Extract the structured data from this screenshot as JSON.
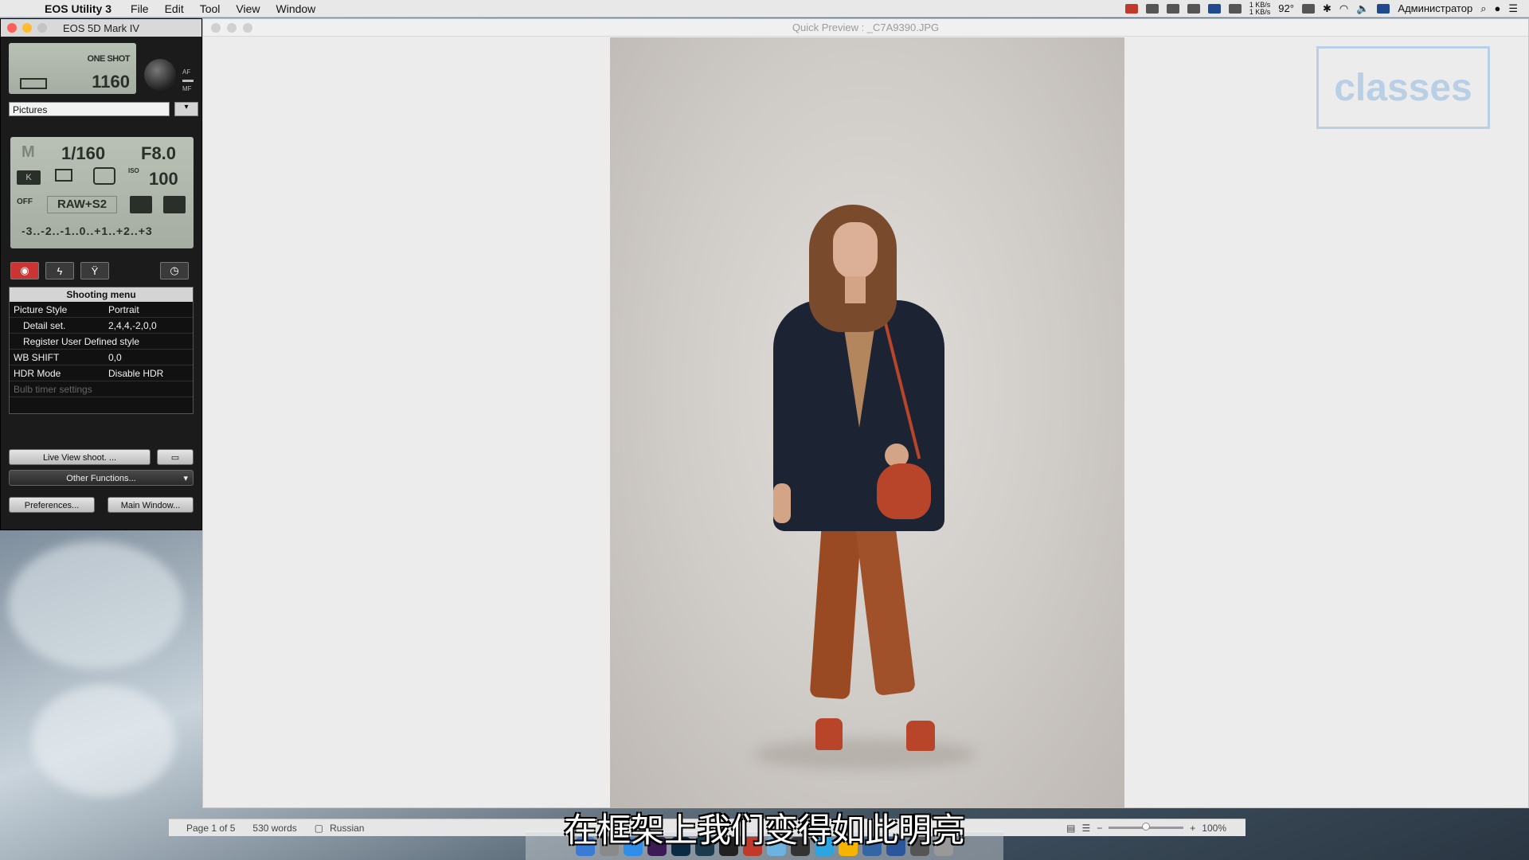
{
  "menubar": {
    "app_name": "EOS Utility 3",
    "menus": [
      "File",
      "Edit",
      "Tool",
      "View",
      "Window"
    ],
    "net_up": "1 KB/s",
    "net_down": "1 KB/s",
    "temperature": "92°",
    "user": "Администратор"
  },
  "eos_window": {
    "title": "EOS 5D Mark IV",
    "af_mode": "ONE SHOT",
    "shots_remaining": "1160",
    "af_label": "AF",
    "mf_label": "MF",
    "destination": "Pictures",
    "exposure": {
      "mode": "M",
      "shutter": "1/160",
      "aperture": "F8.0",
      "wb": "K",
      "iso_label": "ISO",
      "iso": "100",
      "quality": "RAW+S2",
      "alo": "OFF",
      "scale": "-3..-2..-1..0..+1..+2..+3"
    },
    "menu": {
      "title": "Shooting menu",
      "rows": [
        {
          "key": "Picture Style",
          "value": "Portrait",
          "indent": false,
          "disabled": false
        },
        {
          "key": "Detail set.",
          "value": "2,4,4,-2,0,0",
          "indent": true,
          "disabled": false
        },
        {
          "key": "Register User Defined style",
          "value": "",
          "indent": true,
          "disabled": false
        },
        {
          "key": "WB SHIFT",
          "value": "0,0",
          "indent": false,
          "disabled": false
        },
        {
          "key": "HDR Mode",
          "value": "Disable HDR",
          "indent": false,
          "disabled": false
        },
        {
          "key": "Bulb timer settings",
          "value": "",
          "indent": false,
          "disabled": true
        }
      ]
    },
    "buttons": {
      "live_view": "Live View shoot. ...",
      "other_functions": "Other Functions...",
      "preferences": "Preferences...",
      "main_window": "Main Window..."
    }
  },
  "preview": {
    "title": "Quick Preview : _C7A9390.JPG"
  },
  "logo": {
    "text": "classes"
  },
  "statusbar": {
    "page": "Page 1 of 5",
    "words": "530 words",
    "language": "Russian",
    "zoom": "100%",
    "zoom_minus": "−",
    "zoom_plus": "+",
    "zoom_level": 0.5
  },
  "subtitle": "在框架上我们变得如此明亮",
  "colors": {
    "coat": "#1c2433",
    "pants": "#9a4a22",
    "bag": "#b8452a",
    "hair": "#7a4a2c",
    "backdrop": "#cfcbc7",
    "active_tab": "#cc3333"
  }
}
